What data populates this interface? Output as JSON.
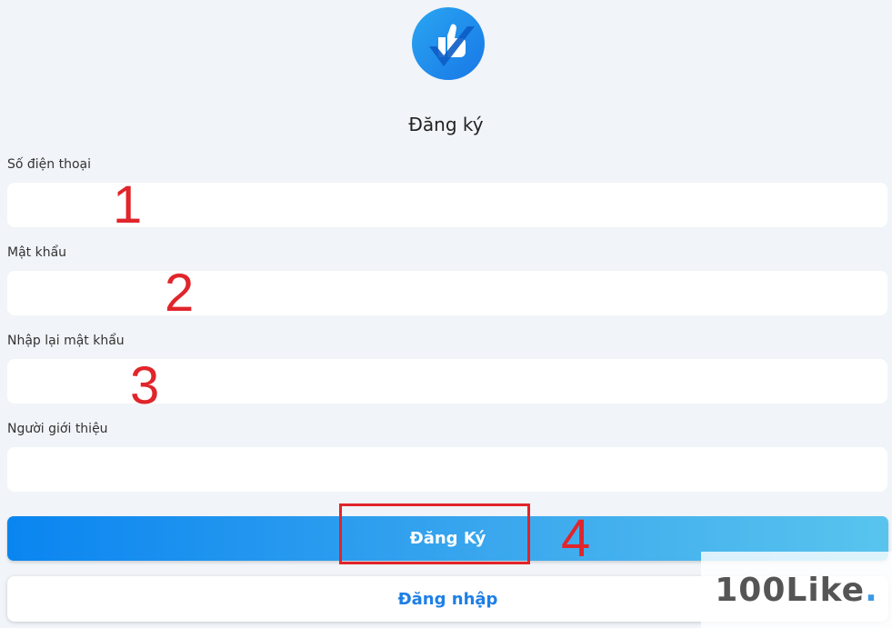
{
  "title": "Đăng ký",
  "fields": [
    {
      "label": "Số điện thoại",
      "value": "",
      "step": "1"
    },
    {
      "label": "Mật khẩu",
      "value": "",
      "step": "2"
    },
    {
      "label": "Nhập lại mật khẩu",
      "value": "",
      "step": "3"
    },
    {
      "label": "Người giới thiệu",
      "value": ""
    }
  ],
  "buttons": {
    "register_label": "Đăng Ký",
    "register_step": "4",
    "login_label": "Đăng nhập"
  },
  "watermark": {
    "text": "100Like",
    "dot": "."
  },
  "colors": {
    "background": "#f1f4f8",
    "accent": "#1d7fe6",
    "annotation": "#e0252b"
  },
  "icons": {
    "logo": "thumbs-up-check-icon"
  }
}
